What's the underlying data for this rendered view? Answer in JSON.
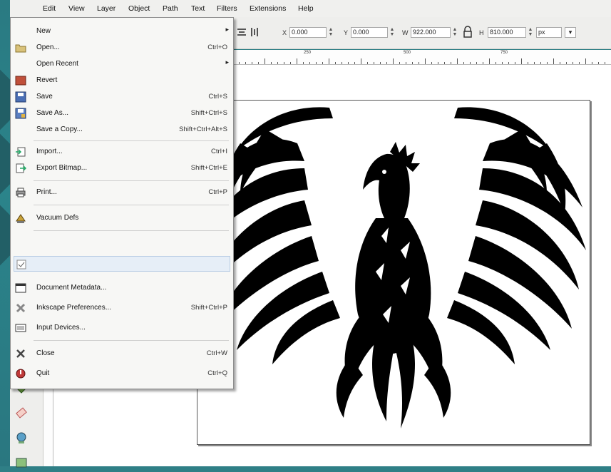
{
  "menubar": {
    "items": [
      "Edit",
      "View",
      "Layer",
      "Object",
      "Path",
      "Text",
      "Filters",
      "Extensions",
      "Help"
    ]
  },
  "toolbar": {
    "x_label": "X",
    "x_value": "0.000",
    "y_label": "Y",
    "y_value": "0.000",
    "w_label": "W",
    "w_value": "922.000",
    "h_label": "H",
    "h_value": "810.000",
    "unit": "px"
  },
  "ruler": {
    "labels": [
      "250",
      "500",
      "750"
    ]
  },
  "file_menu": {
    "items": [
      {
        "label": "New",
        "shortcut": "",
        "submenu": true,
        "icon": "none"
      },
      {
        "label": "Open...",
        "shortcut": "Ctrl+O",
        "submenu": false,
        "icon": "open-folder-icon"
      },
      {
        "label": "Open Recent",
        "shortcut": "",
        "submenu": true,
        "icon": "none"
      },
      {
        "label": "Revert",
        "shortcut": "",
        "submenu": false,
        "icon": "revert-icon"
      },
      {
        "label": "Save",
        "shortcut": "Ctrl+S",
        "submenu": false,
        "icon": "save-icon"
      },
      {
        "label": "Save As...",
        "shortcut": "Shift+Ctrl+S",
        "submenu": false,
        "icon": "save-as-icon"
      },
      {
        "label": "Save a Copy...",
        "shortcut": "Shift+Ctrl+Alt+S",
        "submenu": false,
        "icon": "none"
      },
      {
        "label": "Import...",
        "shortcut": "Ctrl+I",
        "submenu": false,
        "icon": "import-icon"
      },
      {
        "label": "Export Bitmap...",
        "shortcut": "Shift+Ctrl+E",
        "submenu": false,
        "icon": "export-icon"
      },
      {
        "label": "Print...",
        "shortcut": "Ctrl+P",
        "submenu": false,
        "icon": "print-icon"
      },
      {
        "label": "Vacuum Defs",
        "shortcut": "",
        "submenu": false,
        "icon": "vacuum-icon"
      },
      {
        "label": "",
        "shortcut": "",
        "submenu": false,
        "icon": "checkbox-icon"
      },
      {
        "label": "Document Metadata...",
        "shortcut": "",
        "submenu": false,
        "icon": "metadata-icon"
      },
      {
        "label": "Inkscape Preferences...",
        "shortcut": "Shift+Ctrl+P",
        "submenu": false,
        "icon": "preferences-icon"
      },
      {
        "label": "Input Devices...",
        "shortcut": "",
        "submenu": false,
        "icon": "input-devices-icon"
      },
      {
        "label": "Close",
        "shortcut": "Ctrl+W",
        "submenu": false,
        "icon": "close-icon"
      },
      {
        "label": "Quit",
        "shortcut": "Ctrl+Q",
        "submenu": false,
        "icon": "quit-icon"
      }
    ]
  },
  "colors": {
    "desktop": "#2a7a82",
    "menu_bg": "#f7f7f5",
    "artwork": "#000000"
  }
}
